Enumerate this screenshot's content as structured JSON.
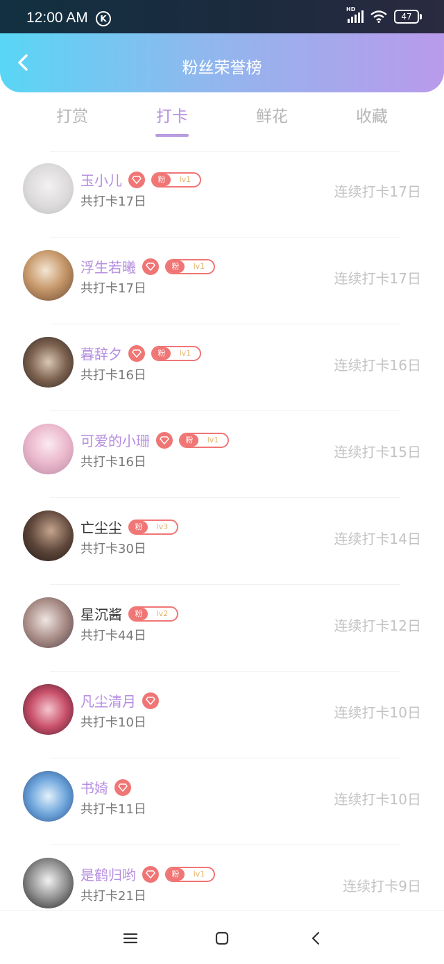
{
  "status": {
    "time": "12:00 AM",
    "k_badge": "K",
    "hd": "HD",
    "battery": "47"
  },
  "header": {
    "title": "粉丝荣誉榜"
  },
  "tabs": [
    {
      "label": "打赏"
    },
    {
      "label": "打卡"
    },
    {
      "label": "鲜花"
    },
    {
      "label": "收藏"
    }
  ],
  "fans": [
    {
      "name": "玉小儿",
      "total": "共打卡17日",
      "streak": "连续打卡17日",
      "fan_label": "粉",
      "level": "lv1"
    },
    {
      "name": "浮生若曦",
      "total": "共打卡17日",
      "streak": "连续打卡17日",
      "fan_label": "粉",
      "level": "lv1"
    },
    {
      "name": "暮辞夕",
      "total": "共打卡16日",
      "streak": "连续打卡16日",
      "fan_label": "粉",
      "level": "lv1"
    },
    {
      "name": "可爱的小珊",
      "total": "共打卡16日",
      "streak": "连续打卡15日",
      "fan_label": "粉",
      "level": "lv1"
    },
    {
      "name": "亡尘尘",
      "total": "共打卡30日",
      "streak": "连续打卡14日",
      "fan_label": "粉",
      "level": "lv3"
    },
    {
      "name": "星沉酱",
      "total": "共打卡44日",
      "streak": "连续打卡12日",
      "fan_label": "粉",
      "level": "lv2"
    },
    {
      "name": "凡尘清月",
      "total": "共打卡10日",
      "streak": "连续打卡10日"
    },
    {
      "name": "书婍",
      "total": "共打卡11日",
      "streak": "连续打卡10日"
    },
    {
      "name": "是鹤归哟",
      "total": "共打卡21日",
      "streak": "连续打卡9日",
      "fan_label": "粉",
      "level": "lv1"
    }
  ],
  "colors": {
    "accent": "#b68de0",
    "badge": "#f07575",
    "header_start": "#59d6f5",
    "header_end": "#b99aeb"
  }
}
